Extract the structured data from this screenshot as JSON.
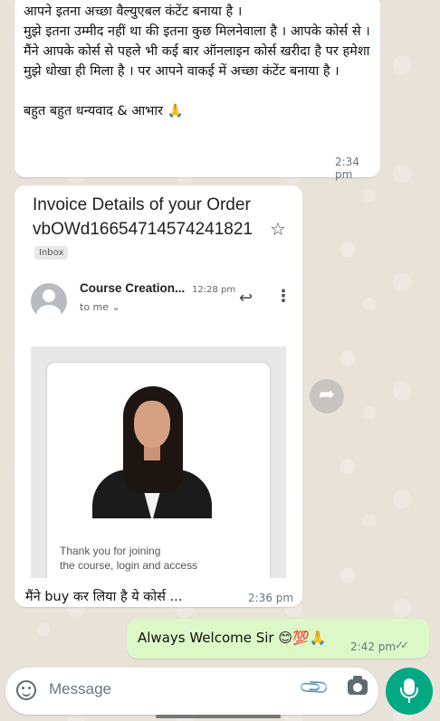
{
  "messages": {
    "first": {
      "text": "आपने इतना अच्छा वैल्युएबल कंटेंट बनाया है ।\nमुझे इतना उम्मीद नहीं था की इतना कुछ मिलनेवाला है । आपके कोर्स से ।\nमैंने आपके कोर्स से पहले भी कई बार ऑनलाइन कोर्स खरीदा है पर हमेशा मुझे धोखा ही मिला है । पर आपने वाकई में अच्छा कंटेंट बनाया है ।\n\nबहुत बहुत धन्यवाद & आभार 🙏",
      "time": "2:34 pm"
    },
    "second": {
      "invoice_title": "Invoice Details of your Order\nvbOWd16654714574241821",
      "label": "Inbox",
      "sender": "Course Creation...",
      "sent_time": "12:28 pm",
      "to": "to me ⌄",
      "email_text": "Thank you for joining\nthe course, login and access",
      "caption": "मैंने buy कर लिया है ये कोर्स ...",
      "time": "2:36 pm"
    },
    "third": {
      "text": "Always Welcome Sir 😊💯🙏",
      "time": "2:42 pm",
      "ticks": "✓✓"
    }
  },
  "composer": {
    "placeholder": "Message"
  },
  "icons": {
    "star": "☆",
    "reply": "↩",
    "more": "⋮",
    "forward": "➦",
    "attach": "📎"
  }
}
